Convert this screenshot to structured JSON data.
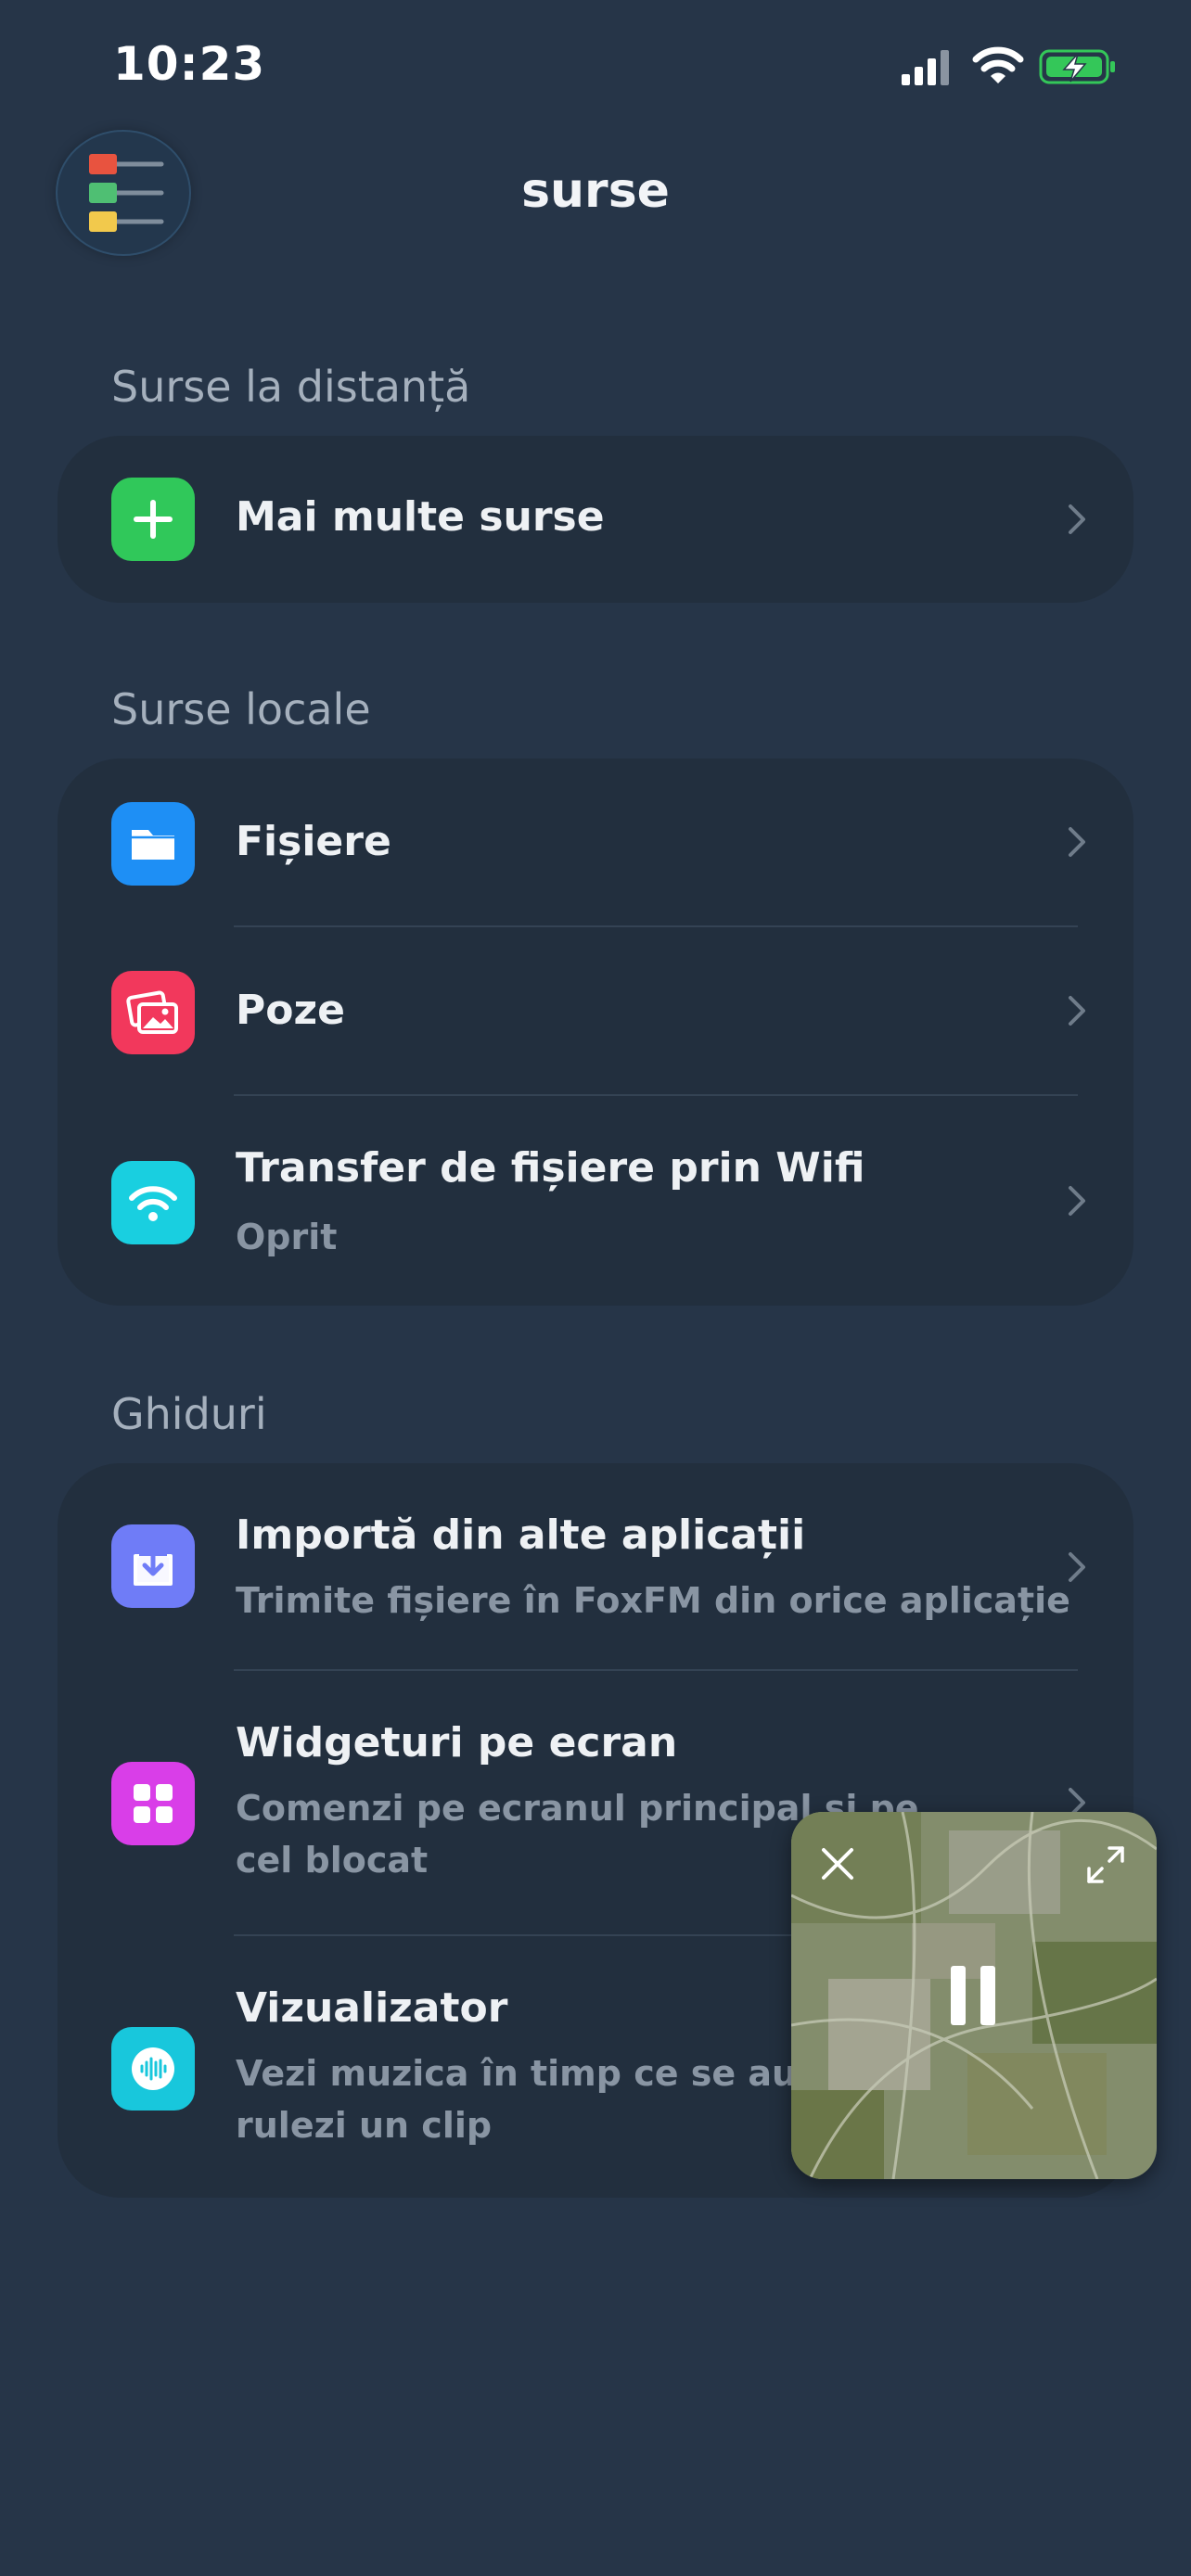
{
  "status_bar": {
    "time": "10:23",
    "signal_icon": "cellular-signal-icon",
    "wifi_icon": "wifi-icon",
    "battery_icon": "battery-charging-icon"
  },
  "header": {
    "title": "surse",
    "menu_icon": "colored-list-menu-icon"
  },
  "sections": {
    "remote": {
      "title": "Surse la distanță",
      "items": [
        {
          "title": "Mai multe surse",
          "icon": "plus-icon",
          "icon_color": "#30c85a"
        }
      ]
    },
    "local": {
      "title": "Surse locale",
      "items": [
        {
          "title": "Fișiere",
          "icon": "folder-icon",
          "icon_color": "#1e8ff5"
        },
        {
          "title": "Poze",
          "icon": "photos-icon",
          "icon_color": "#f2385c"
        },
        {
          "title": "Transfer de fișiere prin Wifi",
          "subtitle": "Oprit",
          "icon": "wifi-icon",
          "icon_color": "#19cfe0"
        }
      ]
    },
    "guides": {
      "title": "Ghiduri",
      "items": [
        {
          "title": "Importă din alte aplicații",
          "subtitle": "Trimite fișiere în FoxFM din orice aplicație",
          "icon": "import-icon",
          "icon_color": "#6f7cf7"
        },
        {
          "title": "Widgeturi pe ecran",
          "subtitle_line1": "Comenzi pe ecranul principal și pe",
          "subtitle_line2": "cel blocat",
          "icon": "widgets-icon",
          "icon_color": "#d93ee8"
        },
        {
          "title": "Vizualizator",
          "subtitle_line1": "Vezi muzica în timp ce se aude, sau",
          "subtitle_line2": "rulezi un clip",
          "icon": "audio-waveform-icon",
          "icon_color": "#18c7dc"
        }
      ]
    }
  },
  "pip_player": {
    "close_icon": "close-icon",
    "expand_icon": "expand-icon",
    "pause_icon": "pause-icon",
    "state": "playing"
  },
  "colors": {
    "background": "#263548",
    "card": "#222f3e",
    "section_header": "#a5b0bd",
    "subtitle": "#8995a3"
  }
}
